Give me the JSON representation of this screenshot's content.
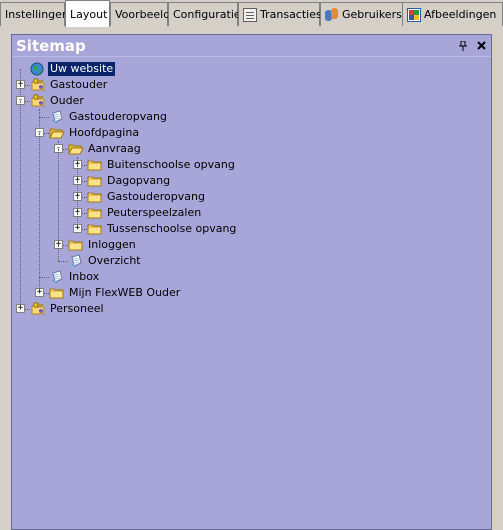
{
  "tabs": [
    {
      "label": "Instellingen",
      "icon": null
    },
    {
      "label": "Layout",
      "icon": null,
      "active": true
    },
    {
      "label": "Voorbeeld",
      "icon": null
    },
    {
      "label": "Configuratie",
      "icon": null
    },
    {
      "label": "Transacties",
      "icon": "document-icon"
    },
    {
      "label": "Gebruikers",
      "icon": "users-icon"
    },
    {
      "label": "Afbeeldingen",
      "icon": "images-icon"
    }
  ],
  "panel": {
    "title": "Sitemap",
    "pin_icon": "pin-icon",
    "close_icon": "close-icon"
  },
  "tree": [
    {
      "label": "Uw website",
      "icon": "globe-icon",
      "level": 0,
      "expander": null,
      "selected": true
    },
    {
      "label": "Gastouder",
      "icon": "key-folder-icon",
      "level": 0,
      "expander": "+"
    },
    {
      "label": "Ouder",
      "icon": "key-folder-icon",
      "level": 0,
      "expander": "-"
    },
    {
      "label": "Gastouderopvang",
      "icon": "page-icon",
      "level": 1,
      "expander": null
    },
    {
      "label": "Hoofdpagina",
      "icon": "folder-open-icon",
      "level": 1,
      "expander": "-"
    },
    {
      "label": "Aanvraag",
      "icon": "folder-open-icon",
      "level": 2,
      "expander": "-"
    },
    {
      "label": "Buitenschoolse opvang",
      "icon": "folder-icon",
      "level": 3,
      "expander": "+"
    },
    {
      "label": "Dagopvang",
      "icon": "folder-icon",
      "level": 3,
      "expander": "+"
    },
    {
      "label": "Gastouderopvang",
      "icon": "folder-icon",
      "level": 3,
      "expander": "+"
    },
    {
      "label": "Peuterspeelzalen",
      "icon": "folder-icon",
      "level": 3,
      "expander": "+"
    },
    {
      "label": "Tussenschoolse opvang",
      "icon": "folder-icon",
      "level": 3,
      "expander": "+"
    },
    {
      "label": "Inloggen",
      "icon": "folder-icon",
      "level": 2,
      "expander": "+"
    },
    {
      "label": "Overzicht",
      "icon": "page-icon",
      "level": 2,
      "expander": null
    },
    {
      "label": "Inbox",
      "icon": "page-icon",
      "level": 1,
      "expander": null
    },
    {
      "label": "Mijn FlexWEB Ouder",
      "icon": "folder-icon",
      "level": 1,
      "expander": "+"
    },
    {
      "label": "Personeel",
      "icon": "key-folder-icon",
      "level": 0,
      "expander": "+"
    }
  ]
}
